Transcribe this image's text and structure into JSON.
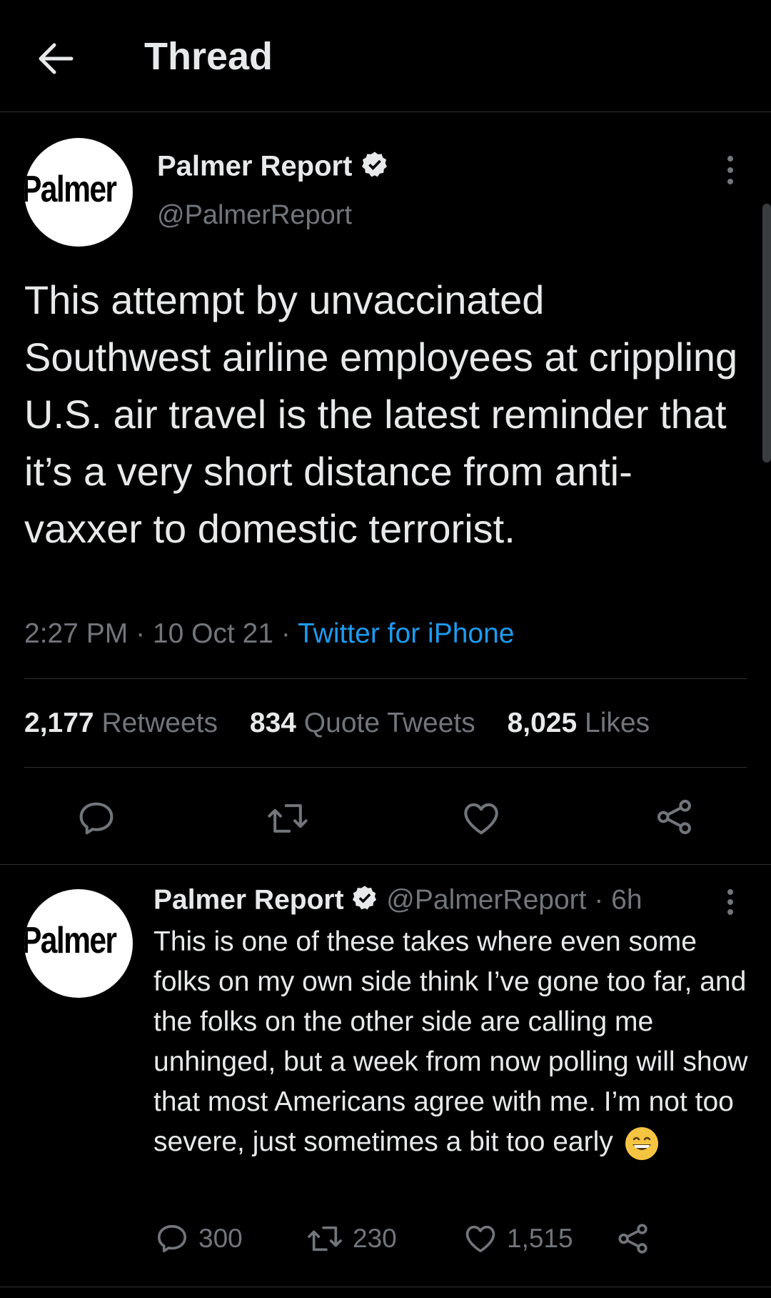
{
  "header": {
    "title": "Thread"
  },
  "main_tweet": {
    "avatar_text": "Palmer",
    "name": "Palmer Report",
    "handle": "@PalmerReport",
    "text": "This attempt by unvaccinated Southwest airline employees at crippling U.S. air travel is the latest reminder that it’s a very short distance from anti-vaxxer to domestic terrorist.",
    "time": "2:27 PM",
    "date": "10 Oct 21",
    "source": "Twitter for iPhone",
    "retweets_count": "2,177",
    "retweets_label": "Retweets",
    "quotes_count": "834",
    "quotes_label": "Quote Tweets",
    "likes_count": "8,025",
    "likes_label": "Likes"
  },
  "reply_tweet": {
    "avatar_text": "Palmer",
    "name": "Palmer Report",
    "handle": "@PalmerReport",
    "age": "6h",
    "text": "This is one of these takes where even some folks on my own side think I’ve gone too far, and the folks on the other side are calling me unhinged, but a week from now polling will show that most Americans agree with me. I’m not too severe, just sometimes a bit too early",
    "replies": "300",
    "retweets": "230",
    "likes": "1,515"
  },
  "colors": {
    "accent": "#1d9bf0",
    "muted": "#71767b",
    "text": "#e7e9ea",
    "background": "#000000"
  }
}
